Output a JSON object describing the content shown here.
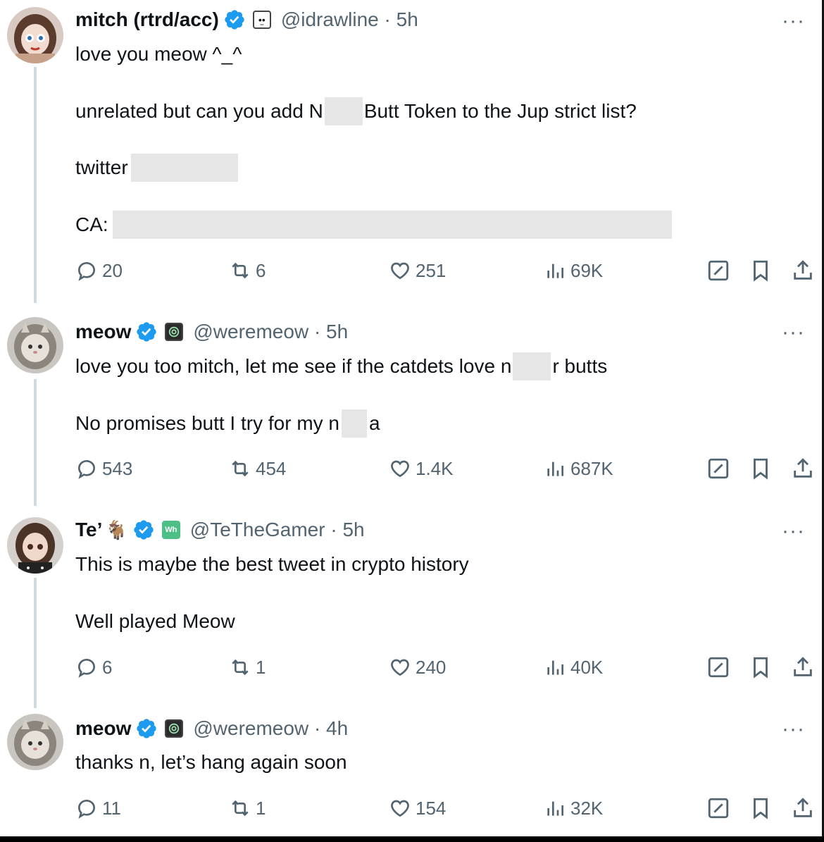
{
  "tweets": [
    {
      "name": "mitch (rtrd/acc)",
      "handle": "@idrawline · 5h",
      "affil_glyph": "•̫•",
      "lines": {
        "l1": "love you meow ^_^",
        "l2a": "unrelated but can you add N",
        "l2b": "Butt Token to the Jup strict list?",
        "l3": "twitter",
        "l4": "CA:"
      },
      "stats": {
        "replies": "20",
        "reposts": "6",
        "likes": "251",
        "views": "69K"
      }
    },
    {
      "name": "meow",
      "handle": "@weremeow · 5h",
      "lines": {
        "l1a": "love you too mitch, let me see if the catdets love n",
        "l1b": "r butts",
        "l2a": "No promises butt I try for my n",
        "l2b": "a"
      },
      "stats": {
        "replies": "543",
        "reposts": "454",
        "likes": "1.4K",
        "views": "687K"
      }
    },
    {
      "name": "Te’",
      "name_glyph": "🐐",
      "handle": "@TeTheGamer · 5h",
      "affil_glyph": "Wh",
      "lines": {
        "l1": "This is maybe the best tweet in crypto history",
        "l2": "Well played Meow"
      },
      "stats": {
        "replies": "6",
        "reposts": "1",
        "likes": "240",
        "views": "40K"
      }
    },
    {
      "name": "meow",
      "handle": "@weremeow · 4h",
      "lines": {
        "l1": "thanks n, let’s hang again soon"
      },
      "stats": {
        "replies": "11",
        "reposts": "1",
        "likes": "154",
        "views": "32K"
      }
    }
  ],
  "more_glyph": "···",
  "colors": {
    "verified": "#1d9bf0",
    "muted": "#536471",
    "thread_line": "#cfd9de",
    "redaction": "#e6e6e6"
  },
  "icons": [
    "reply-icon",
    "repost-icon",
    "like-icon",
    "views-icon",
    "grok-icon",
    "bookmark-icon",
    "share-icon",
    "verified-icon"
  ]
}
